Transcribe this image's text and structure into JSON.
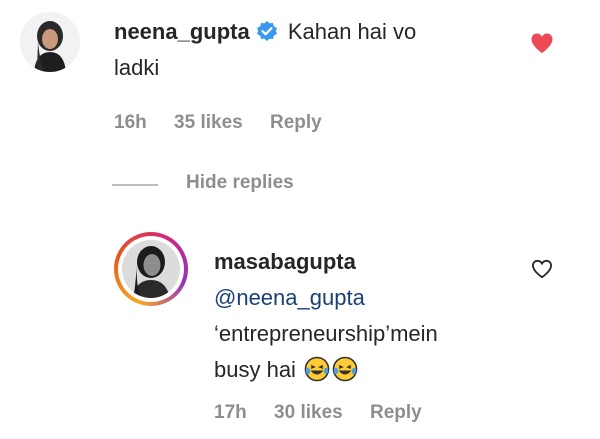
{
  "parent_comment": {
    "username": "neena_gupta",
    "verified_icon": "verified-badge-icon",
    "text_line1": "Kahan hai vo",
    "text_line2": "ladki",
    "time": "16h",
    "likes": "35 likes",
    "reply_label": "Reply",
    "like_icon": "heart-filled-icon",
    "like_color": "#ed4956"
  },
  "replies_toggle": {
    "label": "Hide replies"
  },
  "reply_comment": {
    "username": "masabagupta",
    "mention": "@neena_gupta",
    "text_line1": "‘entrepreneurship’mein",
    "text_line2": "busy hai",
    "emoji": [
      "laughing-tears-emoji",
      "laughing-tears-emoji"
    ],
    "time": "17h",
    "likes": "30 likes",
    "reply_label": "Reply",
    "like_icon": "heart-outline-icon"
  },
  "colors": {
    "text": "#262626",
    "muted": "#8e8e8e",
    "mention": "#1a3f7a",
    "verified": "#3897f0"
  }
}
